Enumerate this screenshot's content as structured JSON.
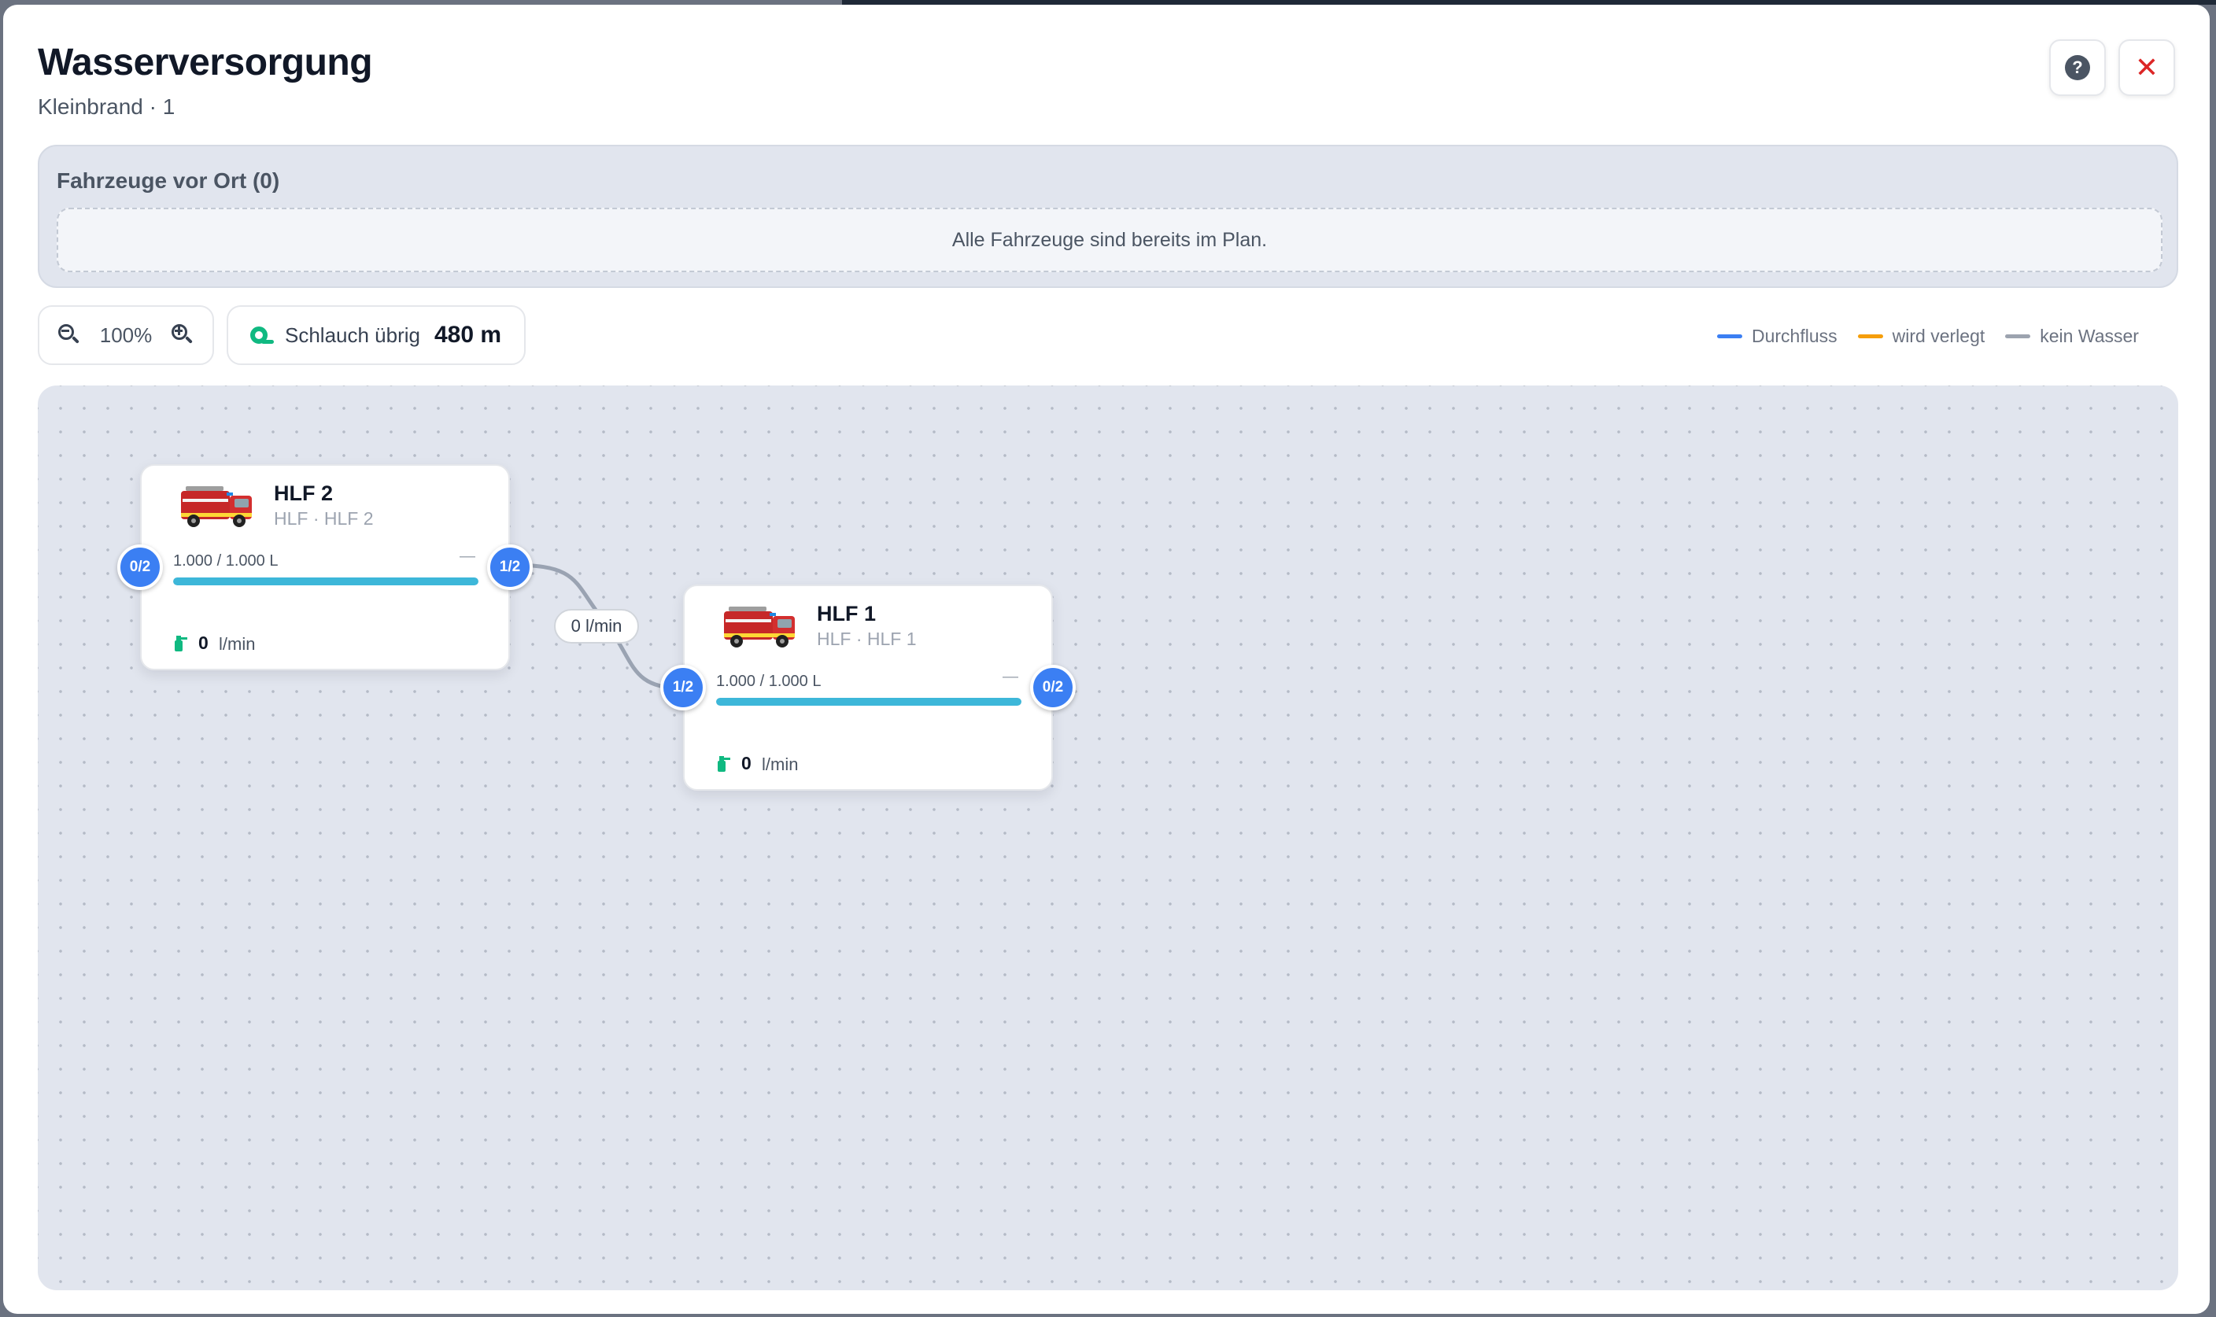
{
  "header": {
    "title": "Wasserversorgung",
    "subtitle": "Kleinbrand · 1",
    "help_label": "?",
    "close_label": "✕"
  },
  "vehicles_panel": {
    "title": "Fahrzeuge vor Ort (0)",
    "empty_message": "Alle Fahrzeuge sind bereits im Plan."
  },
  "toolbar": {
    "zoom_level": "100%",
    "hose_label": "Schlauch übrig",
    "hose_value": "480 m"
  },
  "legend": [
    {
      "label": "Durchfluss",
      "color": "#3b7ff3"
    },
    {
      "label": "wird verlegt",
      "color": "#f59e0b"
    },
    {
      "label": "kein Wasser",
      "color": "#9ca3af"
    }
  ],
  "nodes": [
    {
      "name": "HLF 2",
      "subtitle": "HLF · HLF 2",
      "tank": "1.000 / 1.000 L",
      "tank_fill": 1.0,
      "dash": "—",
      "flow_value": "0",
      "flow_unit": "l/min",
      "port_in": "0/2",
      "port_out": "1/2"
    },
    {
      "name": "HLF 1",
      "subtitle": "HLF · HLF 1",
      "tank": "1.000 / 1.000 L",
      "tank_fill": 1.0,
      "dash": "—",
      "flow_value": "0",
      "flow_unit": "l/min",
      "port_in": "1/2",
      "port_out": "0/2"
    }
  ],
  "connection": {
    "label": "0 l/min",
    "status": "kein Wasser"
  }
}
